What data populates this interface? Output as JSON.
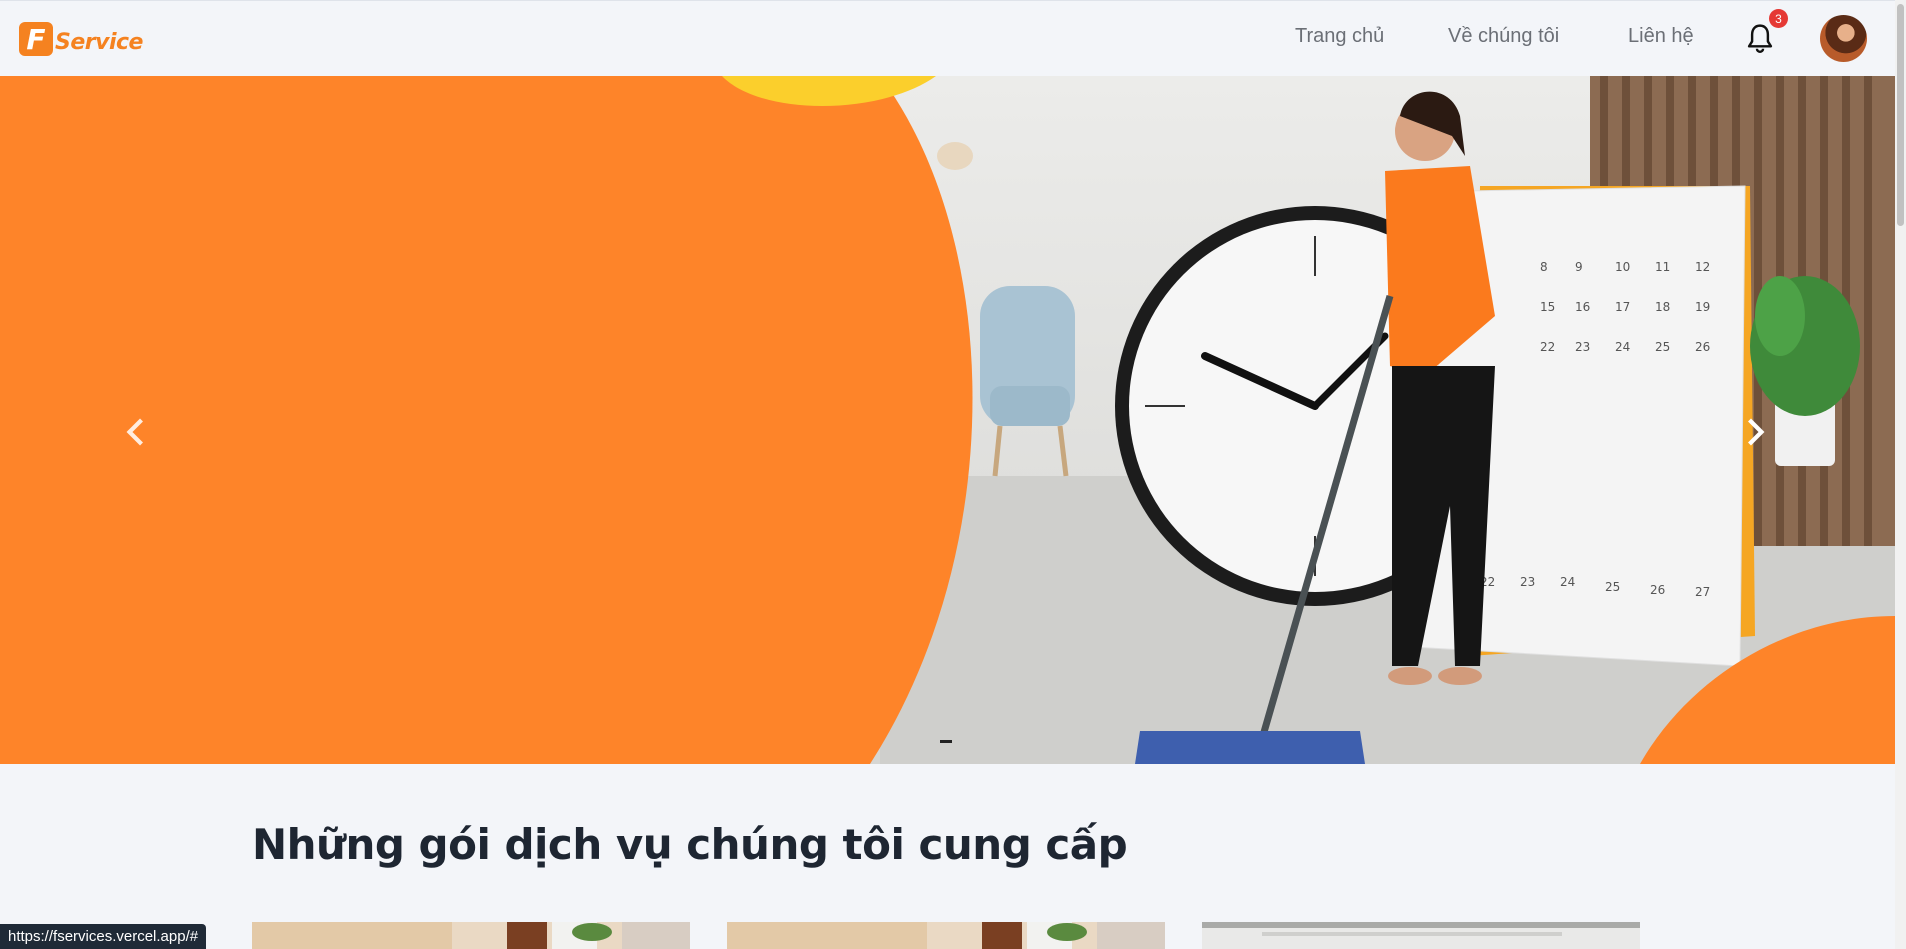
{
  "header": {
    "logo_letter": "F",
    "logo_text": "Service",
    "nav": {
      "home": "Trang chủ",
      "about": "Về chúng tôi",
      "contact": "Liên hệ"
    },
    "notification_count": "3"
  },
  "hero": {
    "brand_color": "#f58220",
    "prev_icon": "chevron-left-icon",
    "next_icon": "chevron-right-icon"
  },
  "services": {
    "title": "Những gói dịch vụ chúng tôi cung cấp"
  },
  "status_bar": {
    "url": "https://fservices.vercel.app/#"
  }
}
